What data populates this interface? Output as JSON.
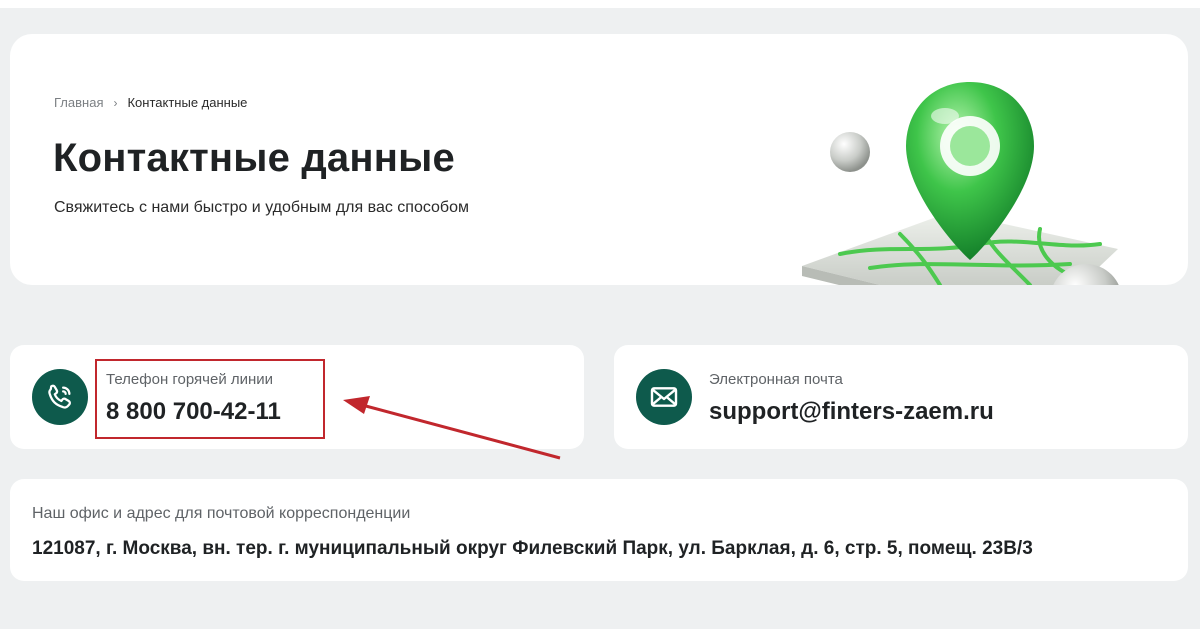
{
  "breadcrumb": {
    "home": "Главная",
    "separator": "›",
    "current": "Контактные данные"
  },
  "header": {
    "title": "Контактные данные",
    "subtitle": "Свяжитесь с нами быстро и удобным для вас способом"
  },
  "contacts": {
    "phone": {
      "label": "Телефон горячей линии",
      "value": "8 800 700-42-11",
      "icon": "phone-icon"
    },
    "email": {
      "label": "Электронная почта",
      "value": "support@finters-zaem.ru",
      "icon": "envelope-icon"
    },
    "address": {
      "label": "Наш офис и адрес для почтовой корреспонденции",
      "value": "121087, г. Москва, вн. тер. г. муниципальный округ Филевский Парк, ул. Барклая, д. 6, стр. 5, помещ. 23В/3"
    }
  },
  "colors": {
    "accent": "#0e5a4c",
    "highlight": "#c1272d",
    "background": "#eef0f1"
  }
}
